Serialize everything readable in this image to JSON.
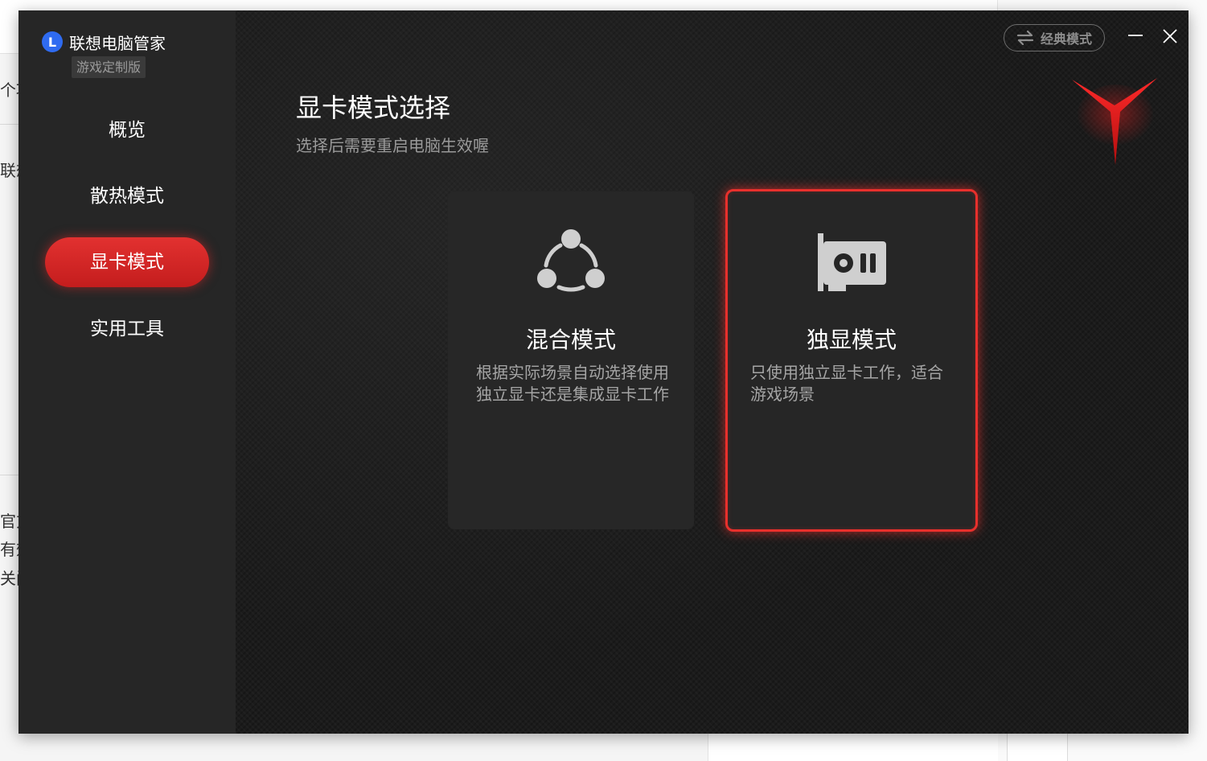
{
  "background": {
    "texts": [
      "个项",
      "联想",
      "官方",
      "有效",
      "关闭"
    ]
  },
  "window": {
    "brand": {
      "name": "联想电脑管家",
      "badge": "游戏定制版"
    },
    "nav": [
      {
        "label": "概览",
        "active": false
      },
      {
        "label": "散热模式",
        "active": false
      },
      {
        "label": "显卡模式",
        "active": true
      },
      {
        "label": "实用工具",
        "active": false
      }
    ],
    "controls": {
      "classic_mode_label": "经典模式"
    },
    "main": {
      "title": "显卡模式选择",
      "subtitle": "选择后需要重启电脑生效喔",
      "cards": [
        {
          "title": "混合模式",
          "desc": "根据实际场景自动选择使用独立显卡还是集成显卡工作",
          "icon": "hybrid-nodes-icon",
          "selected": false
        },
        {
          "title": "独显模式",
          "desc": "只使用独立显卡工作，适合游戏场景",
          "icon": "graphics-card-icon",
          "selected": true
        }
      ]
    },
    "colors": {
      "accent": "#e2302e",
      "brand_blue": "#2f6bf0",
      "sidebar_bg": "#262626",
      "content_bg": "#1b1b1b"
    }
  }
}
